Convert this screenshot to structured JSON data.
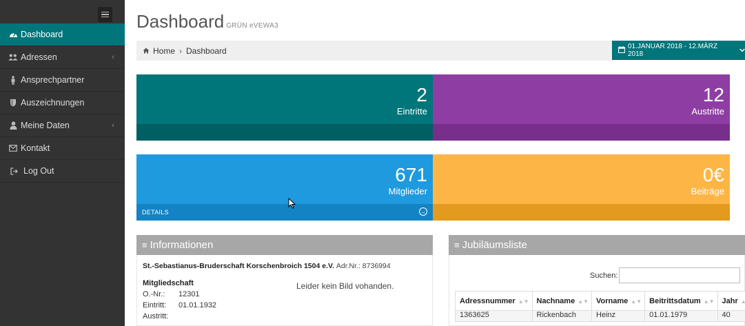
{
  "sidebar": {
    "items": [
      {
        "label": "Dashboard",
        "icon": "dashboard-icon",
        "active": true
      },
      {
        "label": "Adressen",
        "icon": "users-icon",
        "caret": true
      },
      {
        "label": "Ansprechpartner",
        "icon": "person-icon"
      },
      {
        "label": "Auszeichnungen",
        "icon": "shield-icon"
      },
      {
        "label": "Meine Daten",
        "icon": "user-icon",
        "caret": true
      },
      {
        "label": "Kontakt",
        "icon": "envelope-icon"
      },
      {
        "label": "Log Out",
        "icon": "sign-out-icon"
      }
    ]
  },
  "header": {
    "title": "Dashboard",
    "subtitle": "GRÜN eVEWA3"
  },
  "breadcrumb": {
    "home": "Home",
    "current": "Dashboard"
  },
  "date_range": "01.JANUAR 2018 - 12.MÄRZ 2018",
  "stats": {
    "eintritte": {
      "value": "2",
      "label": "Eintritte",
      "color": "#00757a",
      "foot_color": "#005f63"
    },
    "austritte": {
      "value": "12",
      "label": "Austritte",
      "color": "#8e3ea3",
      "foot_color": "#782f8b"
    },
    "mitglieder": {
      "value": "671",
      "label": "Mitglieder",
      "color": "#1f9ade",
      "foot_color": "#1483c3",
      "details": "DETAILS"
    },
    "beitraege": {
      "value": "0€",
      "label": "Beiträge",
      "color": "#fdb645",
      "foot_color": "#e29a1f"
    }
  },
  "info": {
    "title": "Informationen",
    "org_name": "St.-Sebastianus-Bruderschaft Korschenbroich 1504 e.V.",
    "adr_nr": "Adr.Nr.: 8736994",
    "section": "Mitgliedschaft",
    "rows": [
      {
        "label": "O.-Nr.:",
        "value": "12301"
      },
      {
        "label": "Eintritt:",
        "value": "01.01.1932"
      },
      {
        "label": "Austritt:",
        "value": ""
      }
    ],
    "no_image": "Leider kein Bild vohanden."
  },
  "jubilaeum": {
    "title": "Jubiläumsliste",
    "search_label": "Suchen:",
    "search_value": "",
    "columns": [
      "Adressnummer",
      "Nachname",
      "Vorname",
      "Beitrittsdatum",
      "Jahr"
    ],
    "rows": [
      [
        "1363625",
        "Rickenbach",
        "Heinz",
        "01.01.1979",
        "40"
      ]
    ]
  }
}
